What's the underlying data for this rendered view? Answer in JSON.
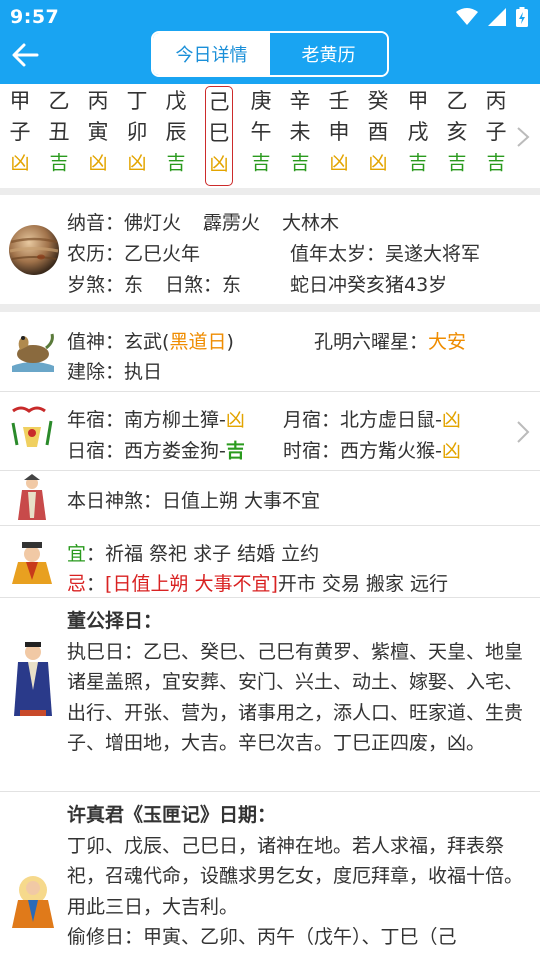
{
  "status": {
    "time": "9:57"
  },
  "tabs": {
    "today": "今日详情",
    "almanac": "老黄历"
  },
  "days": [
    {
      "top": "甲",
      "bottom": "子",
      "luck": "凶"
    },
    {
      "top": "乙",
      "bottom": "丑",
      "luck": "吉"
    },
    {
      "top": "丙",
      "bottom": "寅",
      "luck": "凶"
    },
    {
      "top": "丁",
      "bottom": "卯",
      "luck": "凶"
    },
    {
      "top": "戊",
      "bottom": "辰",
      "luck": "吉"
    },
    {
      "top": "己",
      "bottom": "巳",
      "luck": "凶"
    },
    {
      "top": "庚",
      "bottom": "午",
      "luck": "吉"
    },
    {
      "top": "辛",
      "bottom": "未",
      "luck": "吉"
    },
    {
      "top": "壬",
      "bottom": "申",
      "luck": "凶"
    },
    {
      "top": "癸",
      "bottom": "酉",
      "luck": "凶"
    },
    {
      "top": "甲",
      "bottom": "戌",
      "luck": "吉"
    },
    {
      "top": "乙",
      "bottom": "亥",
      "luck": "吉"
    },
    {
      "top": "丙",
      "bottom": "子",
      "luck": "吉"
    }
  ],
  "selected_day": "己巳",
  "info": {
    "nayin_label": "纳音：",
    "nayin": [
      "佛灯火",
      "霹雳火",
      "大林木"
    ],
    "nongli_label": "农历：",
    "nongli": "乙巳火年",
    "taisui_label": "值年太岁：",
    "taisui": "吴遂大将军",
    "suisha_label": "岁煞：",
    "suisha": "东",
    "risha_label": "日煞：",
    "risha": "东",
    "chong": "蛇日冲癸亥猪43岁"
  },
  "zhishen": {
    "label": "值神：",
    "value": "玄武(",
    "type": "黑道日",
    "close": ")",
    "kongming_label": "孔明六曜星：",
    "kongming": "大安",
    "jianchu_label": "建除：",
    "jianchu": "执日"
  },
  "xiu": {
    "nian_label": "年宿：",
    "nian": "南方柳土獐-",
    "nian_luck": "凶",
    "yue_label": "月宿：",
    "yue": "北方虚日鼠-",
    "yue_luck": "凶",
    "ri_label": "日宿：",
    "ri": "西方娄金狗-",
    "ri_luck": "吉",
    "shi_label": "时宿：",
    "shi": "西方觜火猴-",
    "shi_luck": "凶"
  },
  "shensha": {
    "label": "本日神煞：",
    "value": "日值上朔 大事不宜"
  },
  "yiji": {
    "yi_label": "宜",
    "yi": "：祈福 祭祀 求子 结婚 立约",
    "ji_label": "忌",
    "ji_colon": "：",
    "ji_warn": "[日值上朔 大事不宜]",
    "ji": "开市 交易 搬家 远行"
  },
  "dong": {
    "title": "董公择日：",
    "body": "执巳日：乙巳、癸巳、己巳有黄罗、紫檀、天皇、地皇诸星盖照，宜安葬、安门、兴土、动土、嫁娶、入宅、出行、开张、营为，诸事用之，添人口、旺家道、生贵子、增田地，大吉。辛巳次吉。丁巳正四废，凶。"
  },
  "xu": {
    "title": "许真君《玉匣记》日期：",
    "body": "丁卯、戊辰、己巳日，诸神在地。若人求福，拜表祭祀，召魂代命，设醮求男乞女，度厄拜章，收福十倍。用此三日，大吉利。",
    "body2": "偷修日：甲寅、乙卯、丙午（戊午）、丁巳（己"
  },
  "colors": {
    "header": "#19a4f2",
    "ji": "#2a9a1e",
    "xiong": "#e3a400",
    "orange": "#ef8c00",
    "red": "#d92222"
  }
}
